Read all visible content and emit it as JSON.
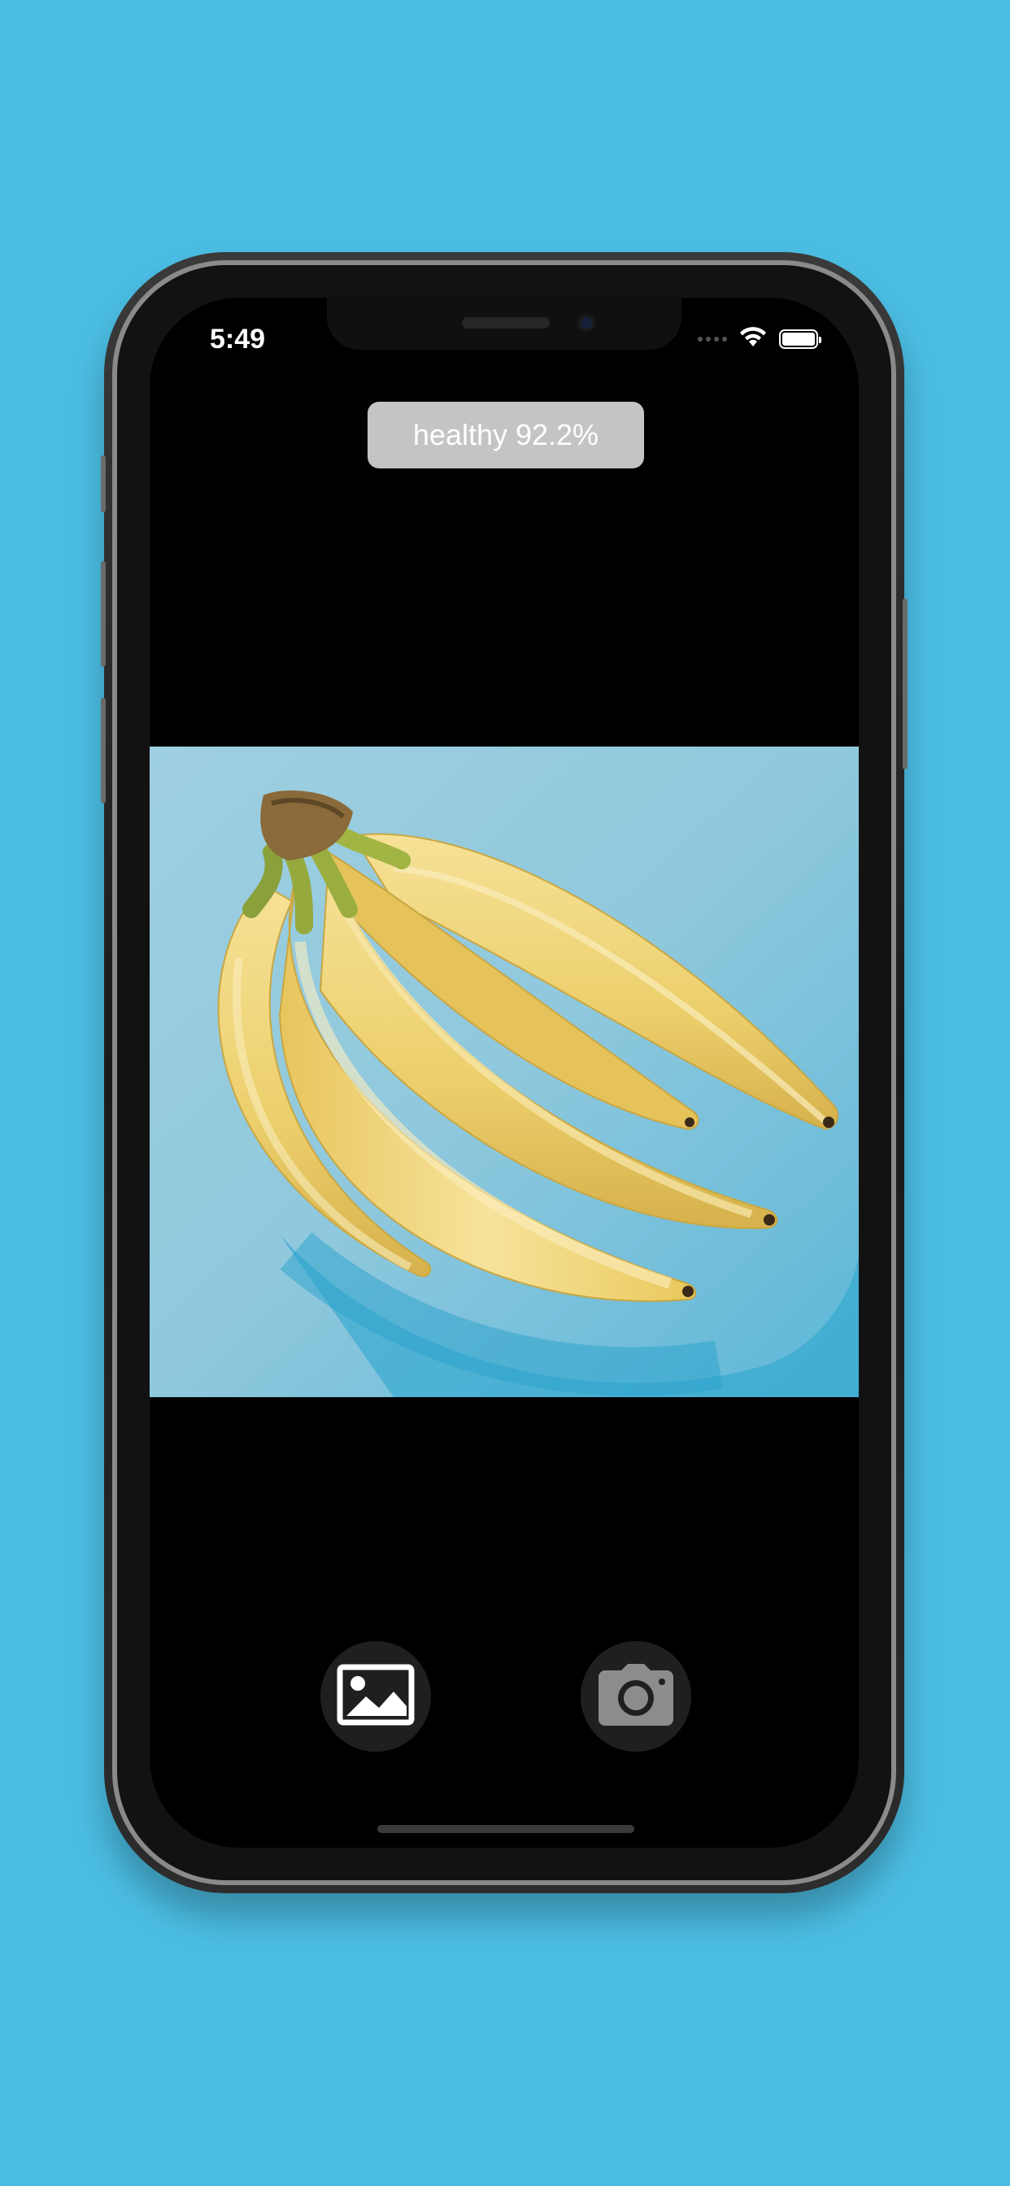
{
  "status_bar": {
    "time": "5:49",
    "wifi_icon": "wifi-icon",
    "battery_icon": "battery-icon",
    "battery_level": 1.0
  },
  "result": {
    "label": "healthy 92.2%"
  },
  "photo": {
    "subject_icon": "banana-photo"
  },
  "toolbar": {
    "gallery_icon": "photo-library-icon",
    "camera_icon": "camera-icon"
  },
  "colors": {
    "background": "#4bbde3",
    "screen": "#000000",
    "pill": "#c4c4c4",
    "button": "#1f1f1f",
    "camera_glyph": "#8c8c8c"
  }
}
